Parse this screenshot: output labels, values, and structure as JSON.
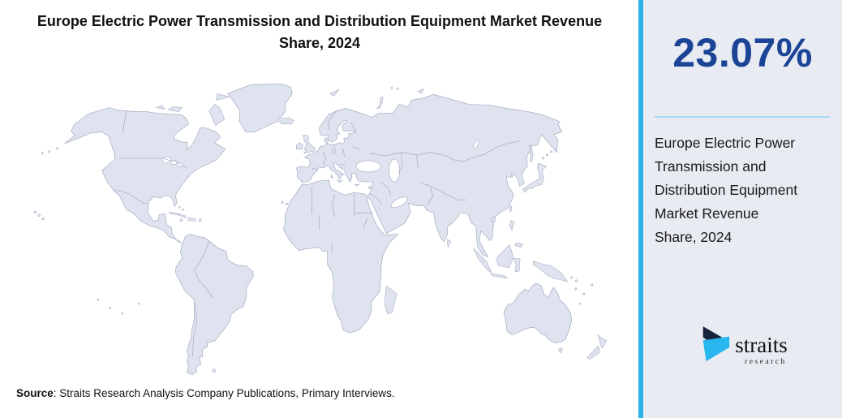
{
  "title": {
    "full": "Europe Electric Power Transmission and Distribution Equipment Market Revenue Share, 2024",
    "lines": [
      "Europe Electric Power Transmission and Distribution Equipment Market Revenue",
      "Share, 2024"
    ]
  },
  "chart_data": {
    "type": "map",
    "map": "world",
    "title": "Europe Electric Power Transmission and Distribution Equipment Market Revenue Share, 2024",
    "series": [
      {
        "name": "Europe",
        "metric": "Electric Power Transmission and Distribution Equipment Market Revenue Share",
        "year": 2024,
        "value": 23.07,
        "unit": "%"
      }
    ],
    "legend": false,
    "notes": "Uniformly shaded world map backdrop with a single callout stat for Europe"
  },
  "stat_panel": {
    "value": "23.07%",
    "description_lines": [
      "Europe Electric Power",
      "Transmission and",
      "Distribution Equipment",
      "Market Revenue",
      "Share, 2024"
    ]
  },
  "source": {
    "label": "Source",
    "text": ": Straits Research Analysis Company Publications, Primary Interviews."
  },
  "logo": {
    "name": "straits",
    "tagline": "research"
  },
  "colors": {
    "accent_stripe": "#2eb2e8",
    "stat_navy": "#1b4496",
    "stat_divider": "#a5d9f2",
    "sidebar_bg": "#e8ebf2",
    "map_fill": "#dfe3ef",
    "map_stroke": "#99a2b8",
    "logo_navy": "#16243c",
    "logo_cyan": "#27b7ee"
  }
}
